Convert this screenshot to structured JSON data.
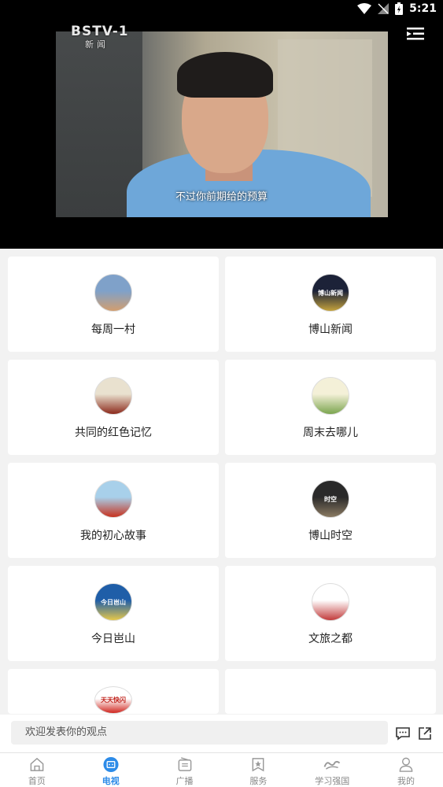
{
  "status_bar": {
    "time": "5:21"
  },
  "video": {
    "channel_logo": "BSTV-1",
    "channel_sub": "新闻",
    "subtitle": "不过你前期给的预算"
  },
  "programs": [
    {
      "label": "每周一村",
      "thumb_text": "",
      "thumb_colors": [
        "#7fa1c9",
        "#d29e6f"
      ]
    },
    {
      "label": "博山新闻",
      "thumb_text": "博山新闻",
      "thumb_colors": [
        "#1c2238",
        "#c4a23c"
      ]
    },
    {
      "label": "共同的红色记忆",
      "thumb_text": "",
      "thumb_colors": [
        "#e9e1cf",
        "#8c2a1c"
      ]
    },
    {
      "label": "周末去哪儿",
      "thumb_text": "",
      "thumb_colors": [
        "#f4f0d8",
        "#7ba54f"
      ]
    },
    {
      "label": "我的初心故事",
      "thumb_text": "",
      "thumb_colors": [
        "#a8d0ea",
        "#c7321f"
      ]
    },
    {
      "label": "博山时空",
      "thumb_text": "时空",
      "thumb_colors": [
        "#2a2a2a",
        "#8a7a62"
      ]
    },
    {
      "label": "今日岜山",
      "thumb_text": "今日岜山",
      "thumb_colors": [
        "#1f5ea8",
        "#e6c84a"
      ]
    },
    {
      "label": "文旅之都",
      "thumb_text": "",
      "thumb_colors": [
        "#ffffff",
        "#c23b3b"
      ]
    },
    {
      "label": "",
      "thumb_text": "天天快闪",
      "thumb_colors": [
        "#ffffff",
        "#d0261f"
      ]
    },
    {
      "label": "",
      "thumb_text": "",
      "thumb_colors": [
        "#ffffff",
        "#ffffff"
      ]
    }
  ],
  "comment": {
    "placeholder": "欢迎发表你的观点"
  },
  "nav": [
    {
      "label": "首页",
      "icon": "home-icon"
    },
    {
      "label": "电视",
      "icon": "tv-icon"
    },
    {
      "label": "广播",
      "icon": "radio-icon"
    },
    {
      "label": "服务",
      "icon": "service-icon"
    },
    {
      "label": "学习强国",
      "icon": "xuexi-icon"
    },
    {
      "label": "我的",
      "icon": "profile-icon"
    }
  ],
  "colors": {
    "accent": "#2c8be8",
    "nav_inactive": "#888888"
  }
}
